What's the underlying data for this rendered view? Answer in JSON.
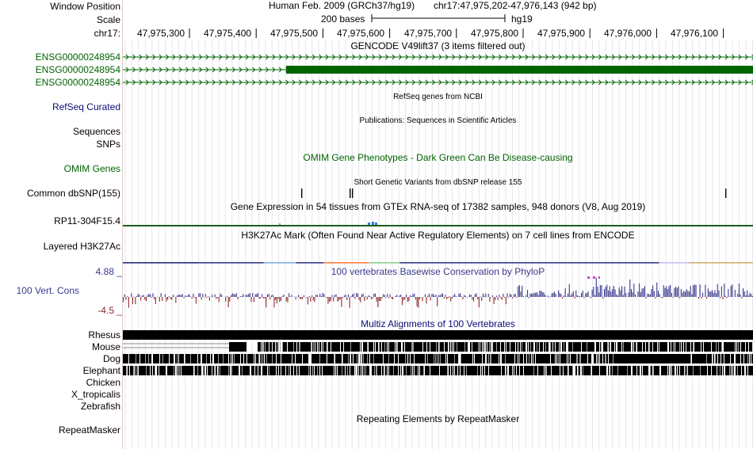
{
  "header": {
    "window_position_label": "Window Position",
    "scale_label": "Scale",
    "chrom_label": "chr17:",
    "assembly": "Human Feb. 2009 (GRCh37/hg19)",
    "position": "chr17:47,975,202-47,976,143 (942 bp)",
    "scale_text": "200 bases",
    "scale_db": "hg19",
    "ruler_ticks": [
      "47,975,300",
      "47,975,400",
      "47,975,500",
      "47,975,600",
      "47,975,700",
      "47,975,800",
      "47,975,900",
      "47,976,000",
      "47,976,100"
    ]
  },
  "tracks": {
    "gencode": {
      "title": "GENCODE V49lift37 (3 items filtered out)",
      "items": [
        "ENSG00000248954",
        "ENSG00000248954",
        "ENSG00000248954"
      ],
      "color": "#006400"
    },
    "refseq": {
      "label": "RefSeq Curated",
      "title": "RefSeq genes from NCBI",
      "color": "#0c0c78"
    },
    "publications": {
      "label": "Sequences",
      "title": "Publications: Sequences in Scientific Articles"
    },
    "snps_group": {
      "label": "SNPs"
    },
    "omim": {
      "label": "OMIM Genes",
      "title": "OMIM Gene Phenotypes - Dark Green Can Be Disease-causing",
      "color": "#006400"
    },
    "dbsnp": {
      "label": "Common dbSNP(155)",
      "title": "Short Genetic Variants from dbSNP release 155"
    },
    "gtex": {
      "label": "RP11-304F15.4",
      "title": "Gene Expression in 54 tissues from GTEx RNA-seq of 17382 samples, 948 donors (V8, Aug 2019)"
    },
    "h3k27ac": {
      "label": "Layered H3K27Ac",
      "title": "H3K27Ac Mark (Often Found Near Active Regulatory Elements) on 7 cell lines from ENCODE"
    },
    "phylop": {
      "label": "100 Vert. Cons",
      "title": "100 vertebrates Basewise Conservation by PhyloP",
      "max_label": "4.88 _",
      "min_label": "-4.5 _",
      "pos_color": "#3a3a8c",
      "neg_color": "#8c2a2a"
    },
    "multiz": {
      "title": "Multiz Alignments of 100 Vertebrates",
      "species": [
        {
          "name": "Rhesus",
          "color": "#0c0c78"
        },
        {
          "name": "Mouse",
          "color": "#006400"
        },
        {
          "name": "Dog",
          "color": "#0c0c78"
        },
        {
          "name": "Elephant",
          "color": "#006400"
        },
        {
          "name": "Chicken",
          "color": "#006400"
        },
        {
          "name": "X_tropicalis",
          "color": "#0c0c78"
        },
        {
          "name": "Zebrafish",
          "color": "#006400"
        }
      ]
    },
    "repeatmasker": {
      "label": "RepeatMasker",
      "title": "Repeating Elements by RepeatMasker"
    }
  }
}
